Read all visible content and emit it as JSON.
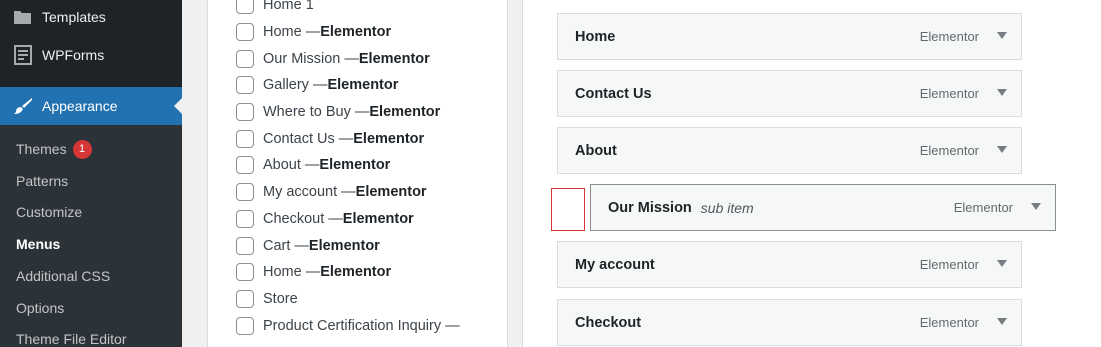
{
  "sidebar": {
    "top_items": [
      {
        "label": "Templates",
        "icon": "folder-icon"
      },
      {
        "label": "WPForms",
        "icon": "form-icon"
      },
      {
        "label": "Appearance",
        "icon": "paintbrush-icon"
      }
    ],
    "submenu": [
      {
        "label": "Themes",
        "badge": "1"
      },
      {
        "label": "Patterns"
      },
      {
        "label": "Customize"
      },
      {
        "label": "Menus"
      },
      {
        "label": "Additional CSS"
      },
      {
        "label": "Options"
      },
      {
        "label": "Theme File Editor"
      }
    ]
  },
  "pages_checklist": [
    {
      "name": "Home 1",
      "suffix": ""
    },
    {
      "name": "Home — ",
      "suffix": "Elementor"
    },
    {
      "name": "Our Mission — ",
      "suffix": "Elementor"
    },
    {
      "name": "Gallery — ",
      "suffix": "Elementor"
    },
    {
      "name": "Where to Buy — ",
      "suffix": "Elementor"
    },
    {
      "name": "Contact Us — ",
      "suffix": "Elementor"
    },
    {
      "name": "About — ",
      "suffix": "Elementor"
    },
    {
      "name": "My account — ",
      "suffix": "Elementor"
    },
    {
      "name": "Checkout — ",
      "suffix": "Elementor"
    },
    {
      "name": "Cart — ",
      "suffix": "Elementor"
    },
    {
      "name": "Home — ",
      "suffix": "Elementor"
    },
    {
      "name": "Store",
      "suffix": ""
    },
    {
      "name": "Product Certification Inquiry —",
      "suffix": ""
    }
  ],
  "menu_structure": [
    {
      "title": "Home",
      "type": "Elementor",
      "subtext": ""
    },
    {
      "title": "Contact Us",
      "type": "Elementor",
      "subtext": ""
    },
    {
      "title": "About",
      "type": "Elementor",
      "subtext": ""
    },
    {
      "title": "Our Mission",
      "type": "Elementor",
      "subtext": "sub item"
    },
    {
      "title": "My account",
      "type": "Elementor",
      "subtext": ""
    },
    {
      "title": "Checkout",
      "type": "Elementor",
      "subtext": ""
    }
  ],
  "colors": {
    "sidebar_bg": "#1d2327",
    "submenu_bg": "#2c3338",
    "accent": "#2271b1",
    "badge": "#d63638",
    "highlight_box": "#d63638"
  }
}
